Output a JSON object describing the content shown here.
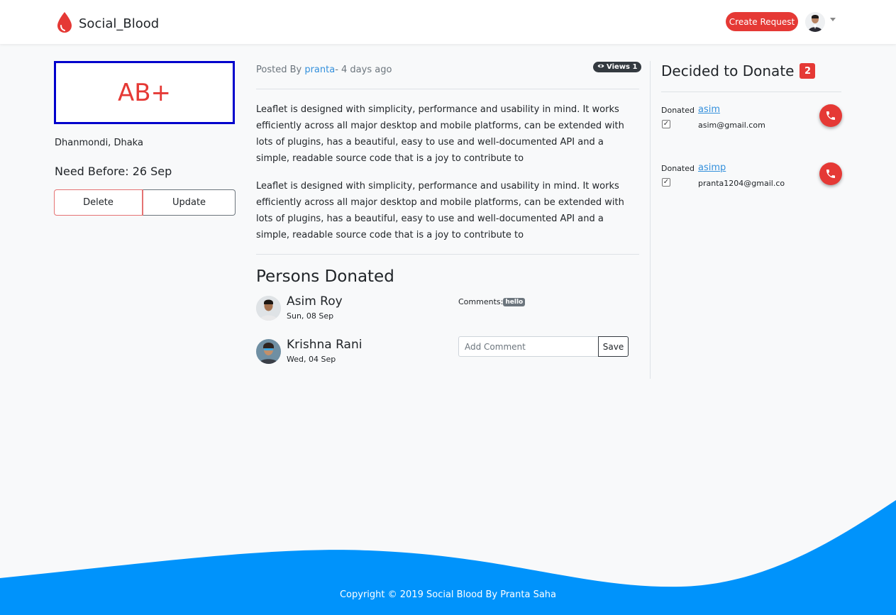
{
  "navbar": {
    "brand": "Social_Blood",
    "create_request_label": "Create Request",
    "brand_icon": "blood-drop-icon",
    "avatar_icon": "user-avatar"
  },
  "request": {
    "blood_group": "AB+",
    "location": "Dhanmondi, Dhaka",
    "need_before": "Need Before: 26 Sep",
    "delete_label": "Delete",
    "update_label": "Update"
  },
  "post": {
    "posted_by_prefix": "Posted By ",
    "author": "pranta",
    "time_ago": "- 4 days ago",
    "views_label": "Views 1",
    "paragraphs": [
      "Leaflet is designed with simplicity, performance and usability in mind. It works efficiently across all major desktop and mobile platforms, can be extended with lots of plugins, has a beautiful, easy to use and well-documented API and a simple, readable source code that is a joy to contribute to",
      "Leaflet is designed with simplicity, performance and usability in mind. It works efficiently across all major desktop and mobile platforms, can be extended with lots of plugins, has a beautiful, easy to use and well-documented API and a simple, readable source code that is a joy to contribute to"
    ]
  },
  "persons_donated": {
    "title": "Persons Donated",
    "donors": [
      {
        "name": "Asim Roy",
        "date": "Sun, 08 Sep",
        "comment_label": "Comments:",
        "comment": "hello"
      },
      {
        "name": "Krishna Rani",
        "date": "Wed, 04 Sep",
        "comment_placeholder": "Add Comment",
        "save_label": "Save"
      }
    ]
  },
  "decided": {
    "title": "Decided to Donate",
    "count": "2",
    "items": [
      {
        "label": "Donated",
        "username": "asim",
        "email": "asim@gmail.com"
      },
      {
        "label": "Donated",
        "username": "asimp",
        "email": "pranta1204@gmail.co"
      }
    ]
  },
  "footer": {
    "copyright": "Copyright © 2019 Social Blood By Pranta Saha"
  },
  "colors": {
    "accent": "#e53935",
    "link": "#3490dc",
    "footer_wave": "#0093fb",
    "blood_box_border": "#0000cc"
  }
}
